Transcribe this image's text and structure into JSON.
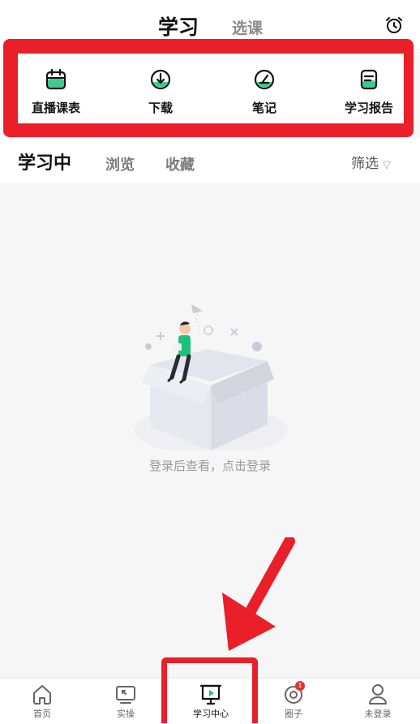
{
  "header": {
    "tabs": [
      {
        "label": "学习"
      },
      {
        "label": "选课"
      }
    ],
    "alarm_icon": "alarm-clock-icon"
  },
  "quick_actions": [
    {
      "label": "直播课表",
      "icon": "calendar-icon"
    },
    {
      "label": "下载",
      "icon": "download-icon"
    },
    {
      "label": "笔记",
      "icon": "note-pen-icon"
    },
    {
      "label": "学习报告",
      "icon": "report-icon"
    }
  ],
  "sub_tabs": {
    "active": "学习中",
    "items": [
      "浏览",
      "收藏"
    ],
    "filter_label": "筛选"
  },
  "empty_state": {
    "message": "登录后查看，点击登录"
  },
  "tabbar": {
    "items": [
      {
        "label": "首页",
        "icon": "home-icon"
      },
      {
        "label": "实操",
        "icon": "practice-screen-icon"
      },
      {
        "label": "学习中心",
        "icon": "study-center-icon"
      },
      {
        "label": "圈子",
        "icon": "circle-icon",
        "badge": "1"
      },
      {
        "label": "未登录",
        "icon": "user-icon"
      }
    ]
  },
  "colors": {
    "accent": "#1fc07a",
    "highlight": "#ea1f29",
    "text_secondary": "#8a8a8a"
  }
}
